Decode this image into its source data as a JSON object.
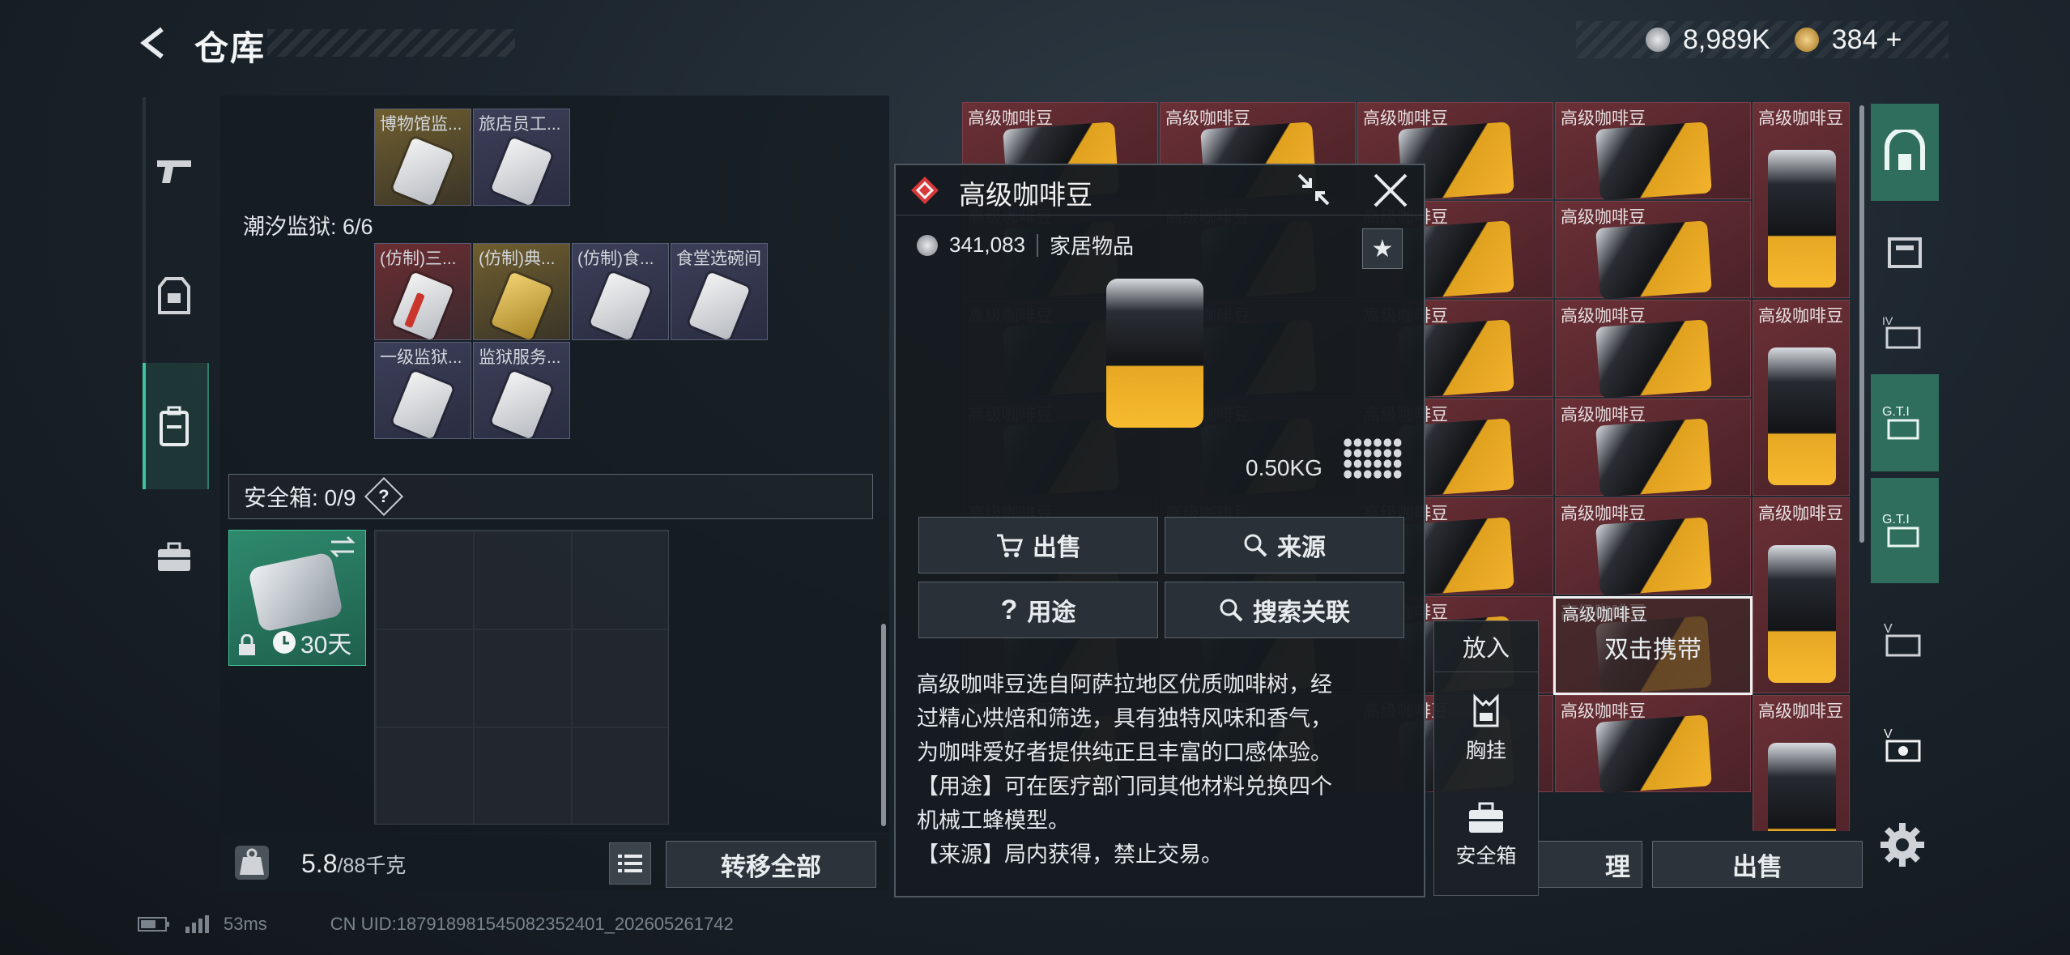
{
  "header": {
    "title": "仓库",
    "currency_silver": "8,989K",
    "currency_gold": "384",
    "plus": "+",
    "colors": {
      "silver": "#c9ccd0",
      "gold": "#d9a646"
    }
  },
  "left_nav": {
    "tabs": [
      {
        "icon": "gun-icon"
      },
      {
        "icon": "armor-vest-icon"
      },
      {
        "icon": "backpack-icon",
        "active": true
      },
      {
        "icon": "briefcase-icon"
      }
    ],
    "accent_color": "#3fc39a"
  },
  "storage": {
    "top_items": [
      "博物馆监...",
      "旅店员工..."
    ],
    "section_label": "潮汐监狱: 6/6",
    "row1": [
      "(仿制)三...",
      "(仿制)典...",
      "(仿制)食...",
      "食堂选碗间"
    ],
    "row2": [
      "一级监狱...",
      "监狱服务..."
    ],
    "safebox_label": "安全箱: 0/9",
    "safebox_help": "?",
    "safebox_duration": "30天",
    "weight_value": "5.8",
    "weight_capacity": "/88千克",
    "transfer_all": "转移全部"
  },
  "right_grid": {
    "item_name": "高级咖啡豆",
    "double_click_hint": "双击携带",
    "manage_label": "理",
    "sell_label": "出售",
    "cell_color": "#5a272d"
  },
  "right_tabs": {
    "icons": [
      "map-base-icon",
      "storage-icon",
      "iv-card-icon",
      "gti-card-icon",
      "gti-card-2-icon",
      "v-card-icon",
      "v-card-2-icon",
      "gear-icon"
    ]
  },
  "popup": {
    "title": "高级咖啡豆",
    "price": "341,083",
    "category": "家居物品",
    "star": "★",
    "weight": "0.50KG",
    "buttons": {
      "sell": "出售",
      "source": "来源",
      "usage": "用途",
      "search_related": "搜索关联"
    },
    "description": "高级咖啡豆选自阿萨拉地区优质咖啡树，经\n过精心烘焙和筛选，具有独特风味和香气，\n为咖啡爱好者提供纯正且丰富的口感体验。\n【用途】可在医疗部门同其他材料兑换四个\n机械工蜂模型。\n【来源】局内获得，禁止交易。"
  },
  "side_popup": {
    "put_in": "放入",
    "chest_rig": "胸挂",
    "safebox": "安全箱"
  },
  "status": {
    "ping": "53ms",
    "uid": "CN UID:18791898154508235240​1_202605261742"
  }
}
